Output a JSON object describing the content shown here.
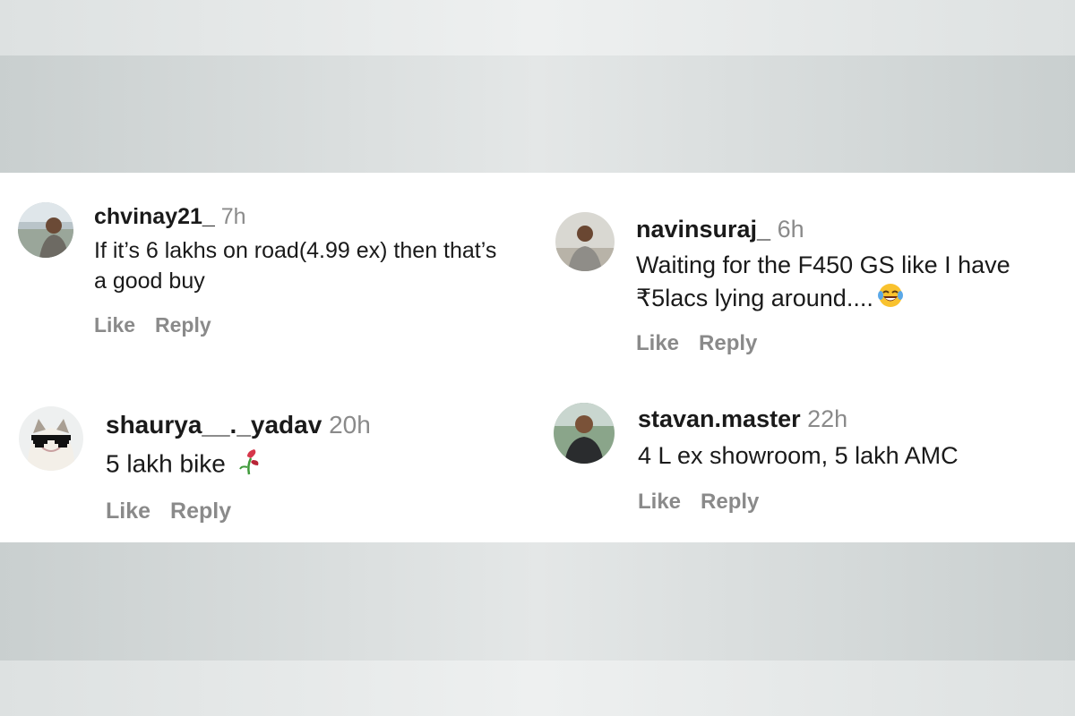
{
  "comments": [
    {
      "username": "chvinay21_",
      "time": "7h",
      "text": "If it’s 6 lakhs on road(4.99 ex) then that’s a good buy",
      "like_label": "Like",
      "reply_label": "Reply"
    },
    {
      "username": "navinsuraj_",
      "time": "6h",
      "text": "Waiting for the F450 GS like I have ₹5lacs lying around....",
      "emoji": "face-with-tears-of-joy",
      "like_label": "Like",
      "reply_label": "Reply"
    },
    {
      "username": "shaurya__._yadav",
      "time": "20h",
      "text": "5 lakh bike",
      "emoji": "wilted-flower",
      "like_label": "Like",
      "reply_label": "Reply"
    },
    {
      "username": "stavan.master",
      "time": "22h",
      "text": "4 L ex showroom, 5 lakh AMC",
      "like_label": "Like",
      "reply_label": "Reply"
    }
  ],
  "colors": {
    "username": "#1a1a1a",
    "muted": "#8a8a8a",
    "panel": "#ffffff",
    "background": "#dfe3e3"
  }
}
